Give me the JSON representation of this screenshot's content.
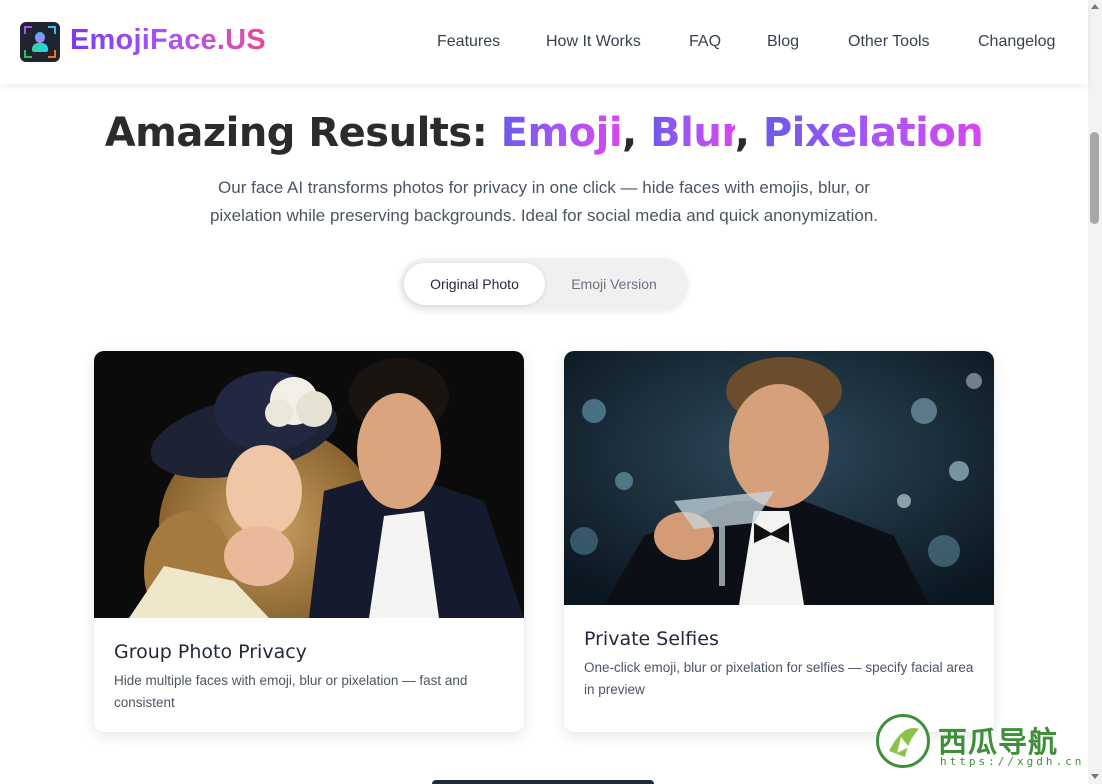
{
  "header": {
    "brand": "EmojiFace.US",
    "nav": [
      "Features",
      "How It Works",
      "FAQ",
      "Blog",
      "Other Tools",
      "Changelog"
    ]
  },
  "hero": {
    "title_prefix": "Amazing Results: ",
    "title_emoji": "Emoji",
    "title_comma1": ", ",
    "title_blur": "Blur",
    "title_comma2": ", ",
    "title_pixel": "Pixelation",
    "subtitle": "Our face AI transforms photos for privacy in one click — hide faces with emojis, blur, or pixelation while preserving backgrounds. Ideal for social media and quick anonymization."
  },
  "toggle": {
    "original": "Original Photo",
    "emoji": "Emoji Version"
  },
  "cards": [
    {
      "title": "Group Photo Privacy",
      "description": "Hide multiple faces with emoji, blur or pixelation — fast and consistent"
    },
    {
      "title": "Private Selfies",
      "description": "One-click emoji, blur or pixelation for selfies — specify facial area in preview"
    }
  ],
  "watermark": {
    "name": "西瓜导航",
    "url": "https://xgdh.cn"
  },
  "colors": {
    "brand_gradient_start": "#7c3aed",
    "brand_gradient_end": "#ec4899",
    "watermark_green": "#3f8f3a"
  }
}
